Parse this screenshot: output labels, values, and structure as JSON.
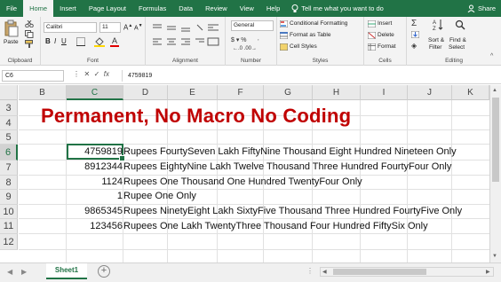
{
  "tabs": [
    "File",
    "Home",
    "Insert",
    "Page Layout",
    "Formulas",
    "Data",
    "Review",
    "View",
    "Help"
  ],
  "active_tab_index": 1,
  "tell_me": "Tell me what you want to do",
  "share": "Share",
  "ribbon": {
    "clipboard": {
      "label": "Clipboard",
      "paste": "Paste"
    },
    "font": {
      "label": "Font",
      "name": "Calibri",
      "size": "11"
    },
    "alignment": {
      "label": "Alignment"
    },
    "number": {
      "label": "Number",
      "format": "General"
    },
    "styles": {
      "label": "Styles",
      "conditional": "Conditional Formatting",
      "format_table": "Format as Table",
      "cell_styles": "Cell Styles"
    },
    "cells": {
      "label": "Cells",
      "insert": "Insert",
      "delete": "Delete",
      "format": "Format"
    },
    "editing": {
      "label": "Editing",
      "sort_filter": "Sort &",
      "sort_filter2": "Filter",
      "find_select": "Find &",
      "find_select2": "Select"
    }
  },
  "formula_bar": {
    "name_box": "C6",
    "fx": "fx",
    "content": "4759819"
  },
  "columns": [
    "B",
    "C",
    "D",
    "E",
    "F",
    "G",
    "H",
    "I",
    "J",
    "K"
  ],
  "selected_column": "C",
  "rows": [
    "3",
    "4",
    "5",
    "6",
    "7",
    "8",
    "9",
    "10",
    "11",
    "12"
  ],
  "selected_row": "6",
  "title_text": "Permanent, No Macro No Coding",
  "data_rows": [
    {
      "number": "4759819",
      "words": "Rupees FourtySeven Lakh FiftyNine Thousand Eight Hundred Nineteen Only"
    },
    {
      "number": "8912344",
      "words": "Rupees EightyNine Lakh Twelve Thousand Three Hundred FourtyFour Only"
    },
    {
      "number": "1124",
      "words": "Rupees One Thousand One Hundred TwentyFour Only"
    },
    {
      "number": "1",
      "words": "Rupee One Only"
    },
    {
      "number": "9865345",
      "words": "Rupees NinetyEight Lakh SixtyFive Thousand Three Hundred FourtyFive Only"
    },
    {
      "number": "123456",
      "words": "Rupees One Lakh TwentyThree Thousand Four Hundred FiftySix Only"
    }
  ],
  "sheet": {
    "name": "Sheet1",
    "add": "+"
  },
  "colors": {
    "accent": "#217346",
    "title": "#c00000"
  }
}
